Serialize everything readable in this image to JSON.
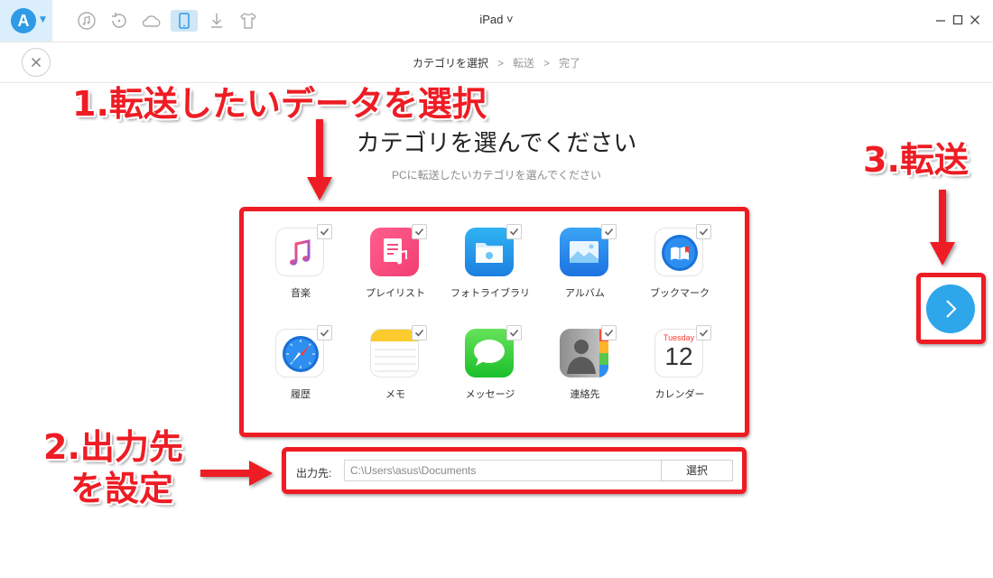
{
  "titlebar": {
    "logo_letter": "A",
    "device_name": "iPad ˅",
    "tools": [
      "music-icon",
      "restore-icon",
      "cloud-icon",
      "device-icon",
      "download-icon",
      "tshirt-icon"
    ]
  },
  "steps": {
    "current": "カテゴリを選択",
    "separator": ">",
    "second": "転送",
    "third": "完了"
  },
  "main": {
    "heading": "カテゴリを選んでください",
    "subheading": "PCに転送したいカテゴリを選んでください"
  },
  "categories": [
    {
      "label": "音楽",
      "icon": "music-app-icon"
    },
    {
      "label": "プレイリスト",
      "icon": "playlist-icon"
    },
    {
      "label": "フォトライブラリ",
      "icon": "photo-library-icon"
    },
    {
      "label": "アルバム",
      "icon": "album-icon"
    },
    {
      "label": "ブックマーク",
      "icon": "bookmark-icon"
    },
    {
      "label": "履歴",
      "icon": "history-icon"
    },
    {
      "label": "メモ",
      "icon": "notes-icon"
    },
    {
      "label": "メッセージ",
      "icon": "messages-icon"
    },
    {
      "label": "連絡先",
      "icon": "contacts-icon"
    },
    {
      "label": "カレンダー",
      "icon": "calendar-icon"
    }
  ],
  "calendar_icon": {
    "weekday": "Tuesday",
    "day": "12"
  },
  "output": {
    "label": "出力先:",
    "path": "C:\\Users\\asus\\Documents",
    "browse_button": "選択"
  },
  "annotations": {
    "step1": "1.転送したいデータを選択",
    "step2_line1": "2.出力先",
    "step2_line2": "を設定",
    "step3": "3.転送"
  },
  "colors": {
    "accent": "#2ea6ea",
    "annotation_red": "#ee1c24"
  }
}
